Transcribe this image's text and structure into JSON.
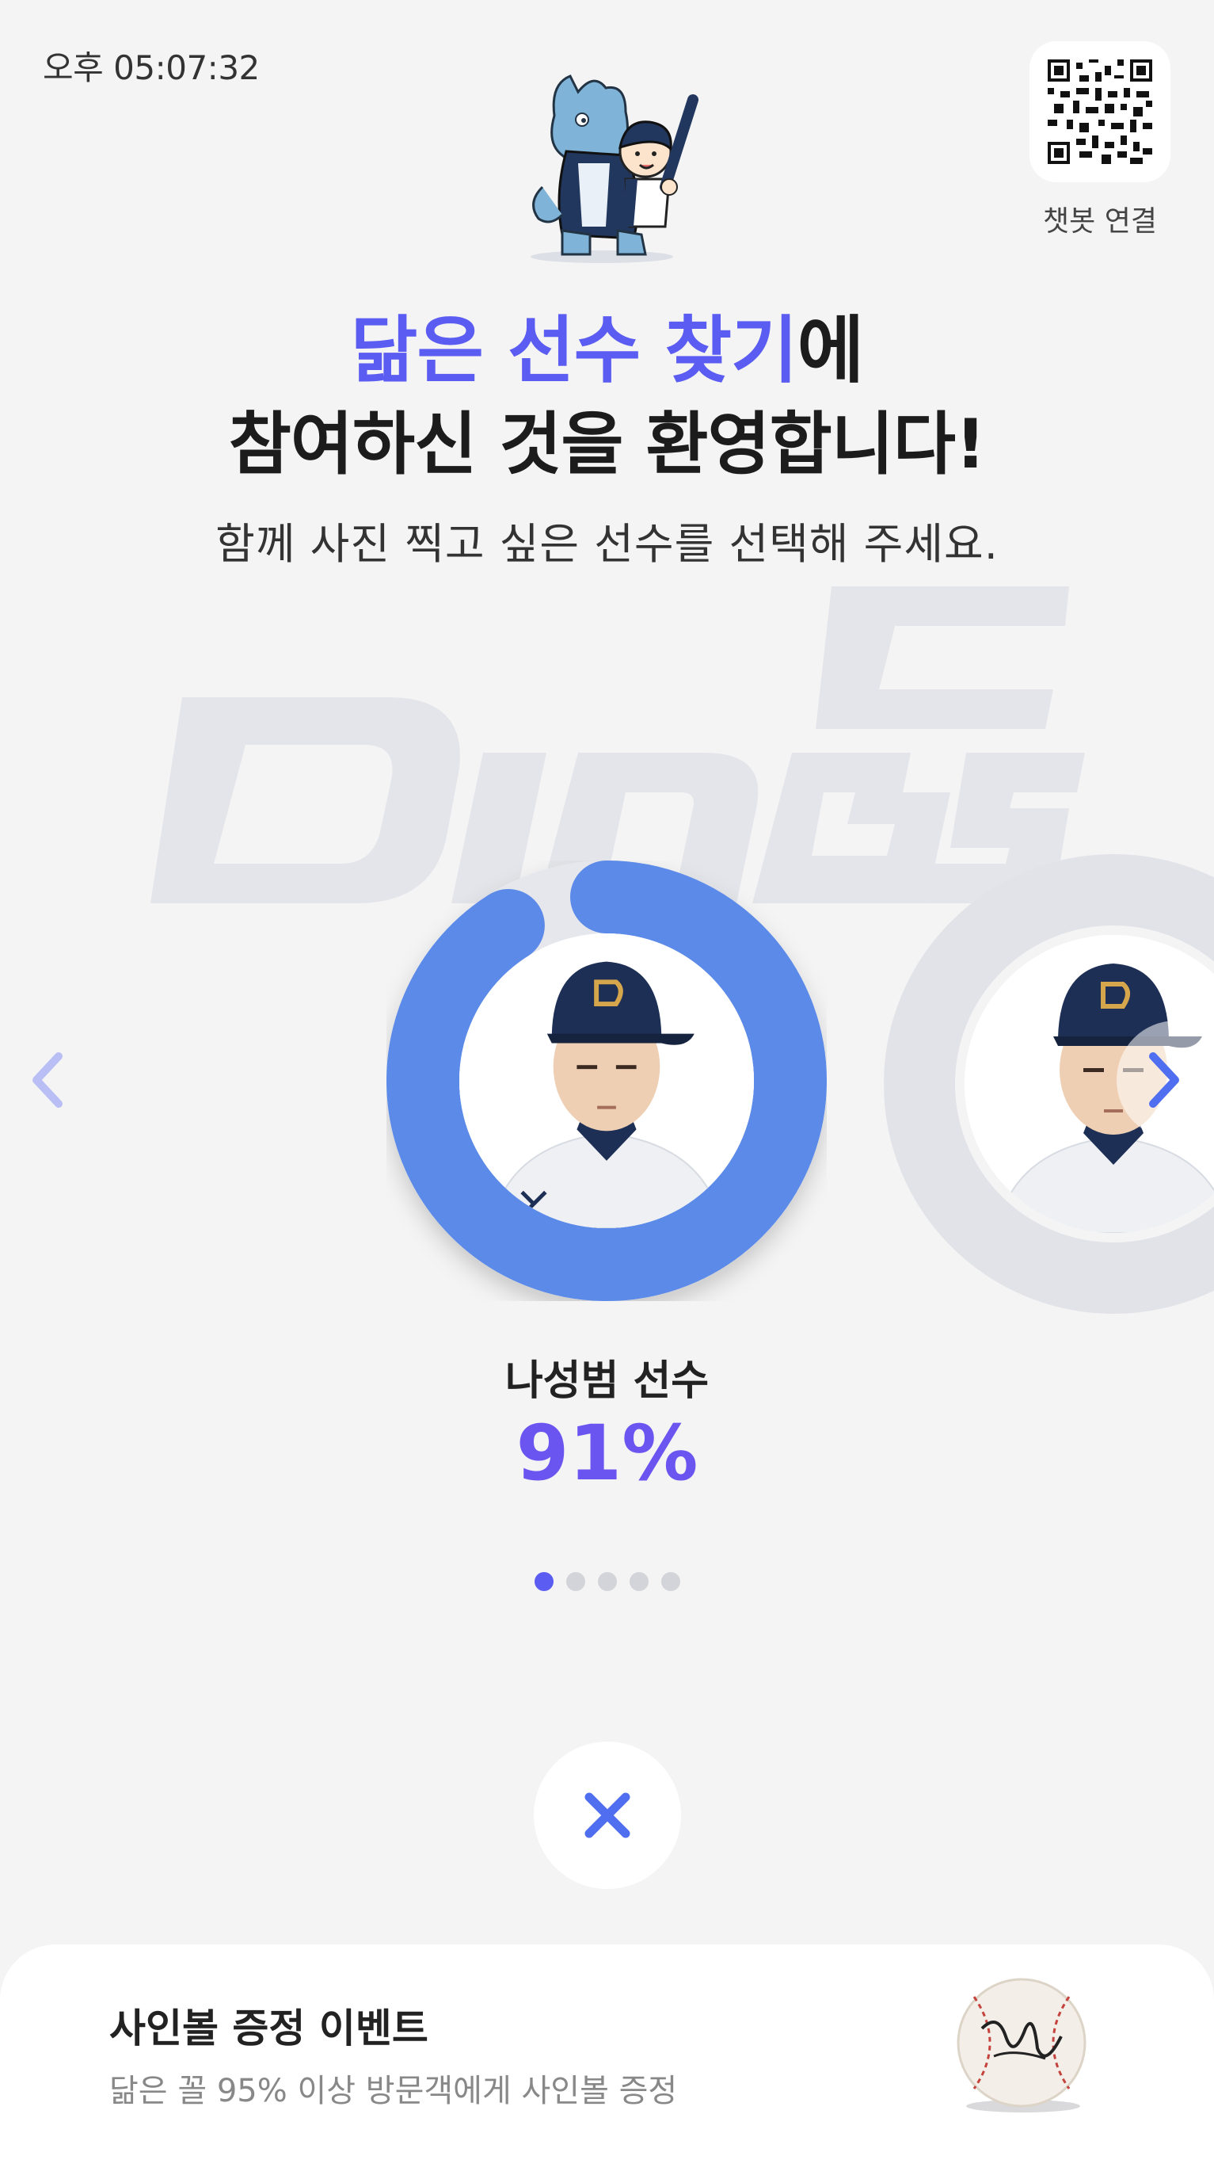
{
  "status": {
    "time": "오후 05:07:32"
  },
  "header": {
    "qr_label": "챗봇 연결",
    "title_highlight": "닮은 선수 찾기",
    "title_suffix": "에",
    "title_line2": "참여하신 것을 환영합니다!",
    "subtitle": "함께 사진 찍고 싶은 선수를 선택해 주세요."
  },
  "carousel": {
    "current_player": {
      "name": "나성범 선수",
      "similarity": "91%",
      "similarity_fraction": 0.91
    },
    "slide_count": 5,
    "active_index": 0
  },
  "event": {
    "title": "사인볼 증정 이벤트",
    "description": "닮은 꼴 95% 이상 방문객에게 사인볼 증정"
  },
  "colors": {
    "accent": "#5b5cf2",
    "ring": "#5b8ae8",
    "percent": "#6b55f0",
    "background": "#f4f4f5"
  },
  "icons": {
    "prev": "chevron-left-icon",
    "next": "chevron-right-icon",
    "close": "close-icon",
    "qr": "qr-code-icon"
  }
}
